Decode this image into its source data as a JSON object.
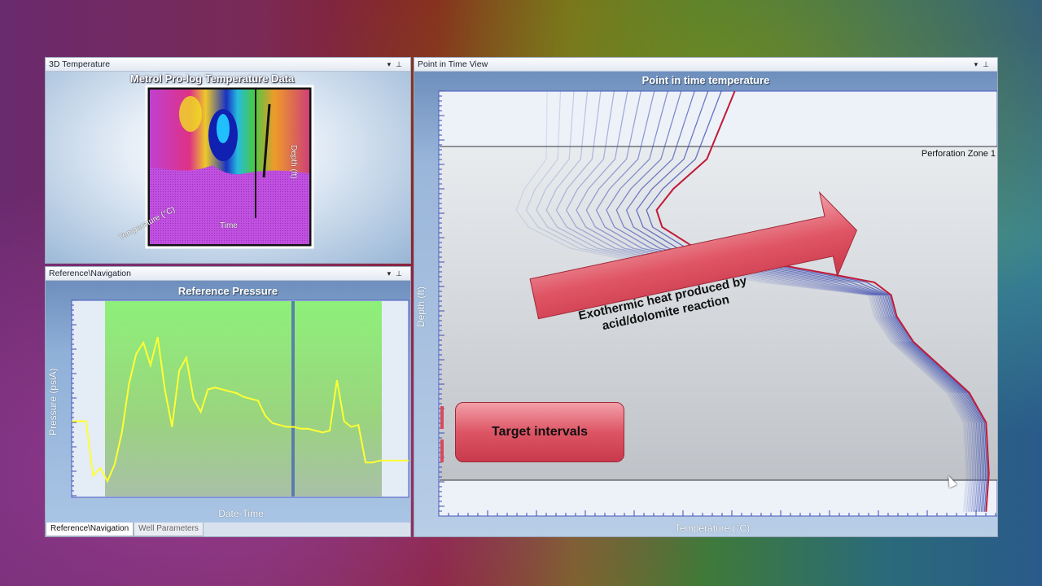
{
  "panels": {
    "temp3d": {
      "header": "3D Temperature",
      "chart_title": "Metrol Pro-log Temperature Data",
      "axis_temperature": "Temperature (°C)",
      "axis_time": "Time",
      "axis_depth": "Depth (ft)"
    },
    "reference": {
      "header": "Reference\\Navigation",
      "chart_title": "Reference Pressure",
      "ylabel": "Pressure (psiA)",
      "xlabel": "Date-Time",
      "tabs": [
        "Reference\\Navigation",
        "Well Parameters"
      ]
    },
    "pointtime": {
      "header": "Point in Time View",
      "chart_title": "Point in time temperature",
      "ylabel": "Depth (ft)",
      "xlabel": "Temperature (°C)",
      "zone_label": "Perforation Zone 1",
      "arrow_text_line1": "Exothermic heat produced by",
      "arrow_text_line2": "acid/dolomite reaction",
      "target_label": "Target intervals"
    }
  },
  "header_controls": {
    "dropdown": "▾",
    "pin": "⊥"
  },
  "colors": {
    "green_band": "#8ef07a",
    "pressure_line": "#ffff33",
    "current_curve": "#c01a3a",
    "callout_red": "#d94a5a",
    "curve_blue": "#3a4ab0"
  },
  "chart_data": [
    {
      "type": "line",
      "title": "Reference Pressure",
      "xlabel": "Date-Time",
      "ylabel": "Pressure (psiA)",
      "series": [
        {
          "values": [
            38,
            38,
            38,
            9,
            13,
            6,
            15,
            32,
            58,
            74,
            80,
            68,
            83,
            55,
            35,
            65,
            72,
            50,
            43,
            55,
            56,
            55,
            54,
            53,
            51,
            50,
            49,
            41,
            37,
            36,
            35,
            35,
            34,
            34,
            33,
            32,
            33,
            60,
            38,
            35,
            36,
            16,
            16,
            17,
            17,
            17,
            17,
            17
          ]
        }
      ]
    },
    {
      "type": "line",
      "title": "Point in time temperature",
      "xlabel": "Temperature (°C)",
      "ylabel": "Depth (ft)",
      "series": [
        {
          "values": [
            [
              0.53,
              0
            ],
            [
              0.48,
              0.16
            ],
            [
              0.42,
              0.23
            ],
            [
              0.39,
              0.28
            ],
            [
              0.4,
              0.32
            ],
            [
              0.46,
              0.37
            ],
            [
              0.53,
              0.39
            ],
            [
              0.7,
              0.43
            ],
            [
              0.78,
              0.45
            ],
            [
              0.81,
              0.48
            ],
            [
              0.82,
              0.53
            ],
            [
              0.85,
              0.59
            ],
            [
              0.9,
              0.65
            ],
            [
              0.95,
              0.71
            ],
            [
              0.98,
              0.78
            ],
            [
              0.985,
              0.9
            ],
            [
              0.98,
              0.99
            ]
          ]
        }
      ]
    }
  ]
}
